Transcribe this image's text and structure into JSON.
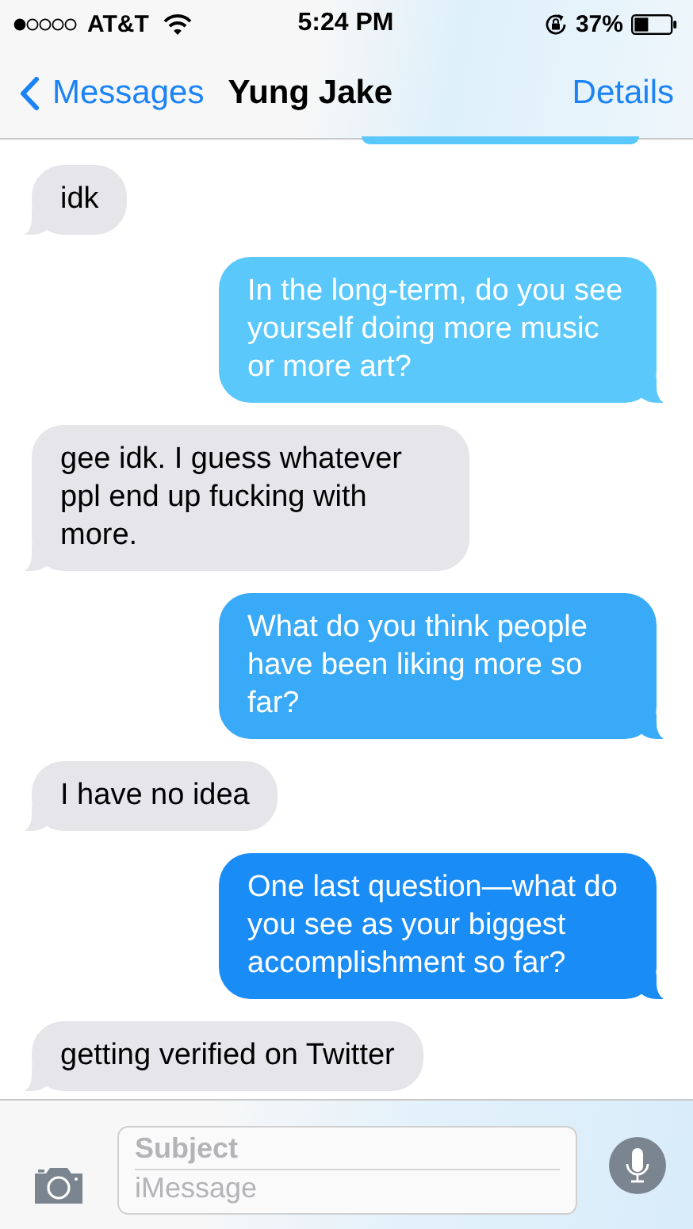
{
  "status_bar": {
    "carrier": "AT&T",
    "time": "5:24 PM",
    "battery": "37%"
  },
  "nav_bar": {
    "back": "Messages",
    "title": "Yung Jake",
    "action": "Details"
  },
  "messages": [
    {
      "kind": "received",
      "text": "idk"
    },
    {
      "kind": "sent",
      "text": "In the long-term, do you see yourself doing more music or more art?"
    },
    {
      "kind": "received",
      "text": "gee idk. I guess whatever ppl end up fucking with more."
    },
    {
      "kind": "sent",
      "text": "What do you think people have been liking more so far?"
    },
    {
      "kind": "received",
      "text": "I have no idea"
    },
    {
      "kind": "sent",
      "text": "One last question—what do you see as your biggest accomplishment so far?"
    },
    {
      "kind": "received",
      "text": "getting verified on Twitter"
    }
  ],
  "composer": {
    "subject_placeholder": "Subject",
    "message_placeholder": "iMessage"
  }
}
